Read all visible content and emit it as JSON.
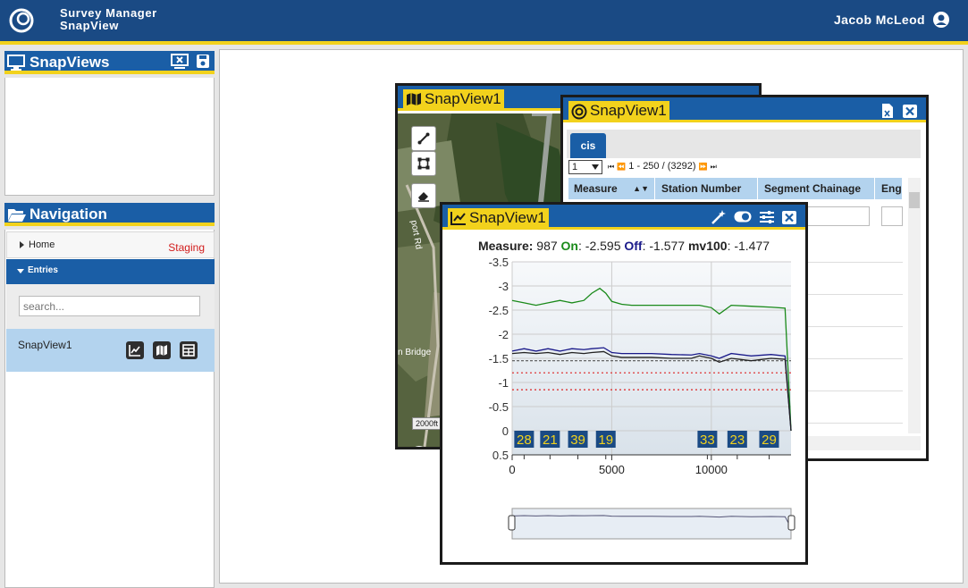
{
  "header": {
    "title_line1": "Survey Manager",
    "title_line2": "SnapView",
    "user_name": "Jacob McLeod",
    "colors": {
      "brand": "#1a4a84",
      "accent": "#f2d21c"
    }
  },
  "snapviews_panel": {
    "title": "SnapViews",
    "icons": [
      "monitor-icon",
      "close-view-icon",
      "save-icon"
    ]
  },
  "navigation_panel": {
    "title": "Navigation",
    "home": {
      "label": "Home",
      "badge": "Staging"
    },
    "entries": {
      "label": "Entries"
    },
    "search": {
      "placeholder": "search..."
    },
    "items": [
      {
        "label": "SnapView1",
        "actions": [
          "chart-icon",
          "map-icon",
          "table-icon"
        ]
      }
    ]
  },
  "map_window": {
    "title": "SnapView1",
    "map_labels": [
      "port Rd",
      "n Bridge"
    ],
    "scale": "2000ft",
    "attribution": "m"
  },
  "table_window": {
    "title": "SnapView1",
    "tab": "cis",
    "pager": {
      "page": "1",
      "range": "1 - 250 / (3292)",
      "controls": [
        "⏮",
        "⏪",
        "⏩",
        "⏭"
      ]
    },
    "columns": [
      "Measure",
      "Station Number",
      "Segment Chainage",
      "Eng"
    ]
  },
  "chart_window": {
    "title": "SnapView1",
    "status": {
      "measure_label": "Measure:",
      "measure_value": "987",
      "on_label": "On",
      "on_value": ": -2.595",
      "off_label": "Off",
      "off_value": ": -1.577",
      "mv_label": "mv100",
      "mv_value": ": -1.477"
    },
    "chart_data": {
      "type": "line",
      "title": "",
      "xlabel": "",
      "ylabel": "",
      "xlim": [
        0,
        14000
      ],
      "ylim": [
        0.5,
        -3.5
      ],
      "xticks": [
        0,
        5000,
        10000
      ],
      "yticks": [
        -3.5,
        -3,
        -2.5,
        -2,
        -1.5,
        -1,
        -0.5,
        0,
        0.5
      ],
      "series": [
        {
          "color": "#1a8a1a",
          "x": [
            0,
            600,
            1200,
            1800,
            2400,
            3000,
            3600,
            4000,
            4400,
            4700,
            5000,
            5500,
            6000,
            7000,
            8000,
            9000,
            9400,
            10000,
            10400,
            11000,
            12000,
            13000,
            13700,
            14000
          ],
          "y": [
            -2.7,
            -2.65,
            -2.6,
            -2.65,
            -2.7,
            -2.65,
            -2.7,
            -2.85,
            -2.95,
            -2.85,
            -2.68,
            -2.62,
            -2.6,
            -2.6,
            -2.6,
            -2.6,
            -2.6,
            -2.55,
            -2.42,
            -2.6,
            -2.58,
            -2.56,
            -2.54,
            0.0
          ]
        },
        {
          "color": "#1a1a8a",
          "x": [
            0,
            600,
            1200,
            1800,
            2400,
            3000,
            3600,
            4000,
            4600,
            5000,
            5500,
            6000,
            7000,
            8000,
            9000,
            9400,
            10000,
            10400,
            11000,
            12000,
            13000,
            13700,
            14000
          ],
          "y": [
            -1.65,
            -1.7,
            -1.65,
            -1.7,
            -1.65,
            -1.7,
            -1.68,
            -1.7,
            -1.72,
            -1.62,
            -1.6,
            -1.6,
            -1.6,
            -1.58,
            -1.57,
            -1.6,
            -1.55,
            -1.5,
            -1.6,
            -1.55,
            -1.58,
            -1.55,
            0.0
          ]
        },
        {
          "color": "#222222",
          "x": [
            0,
            600,
            1200,
            1800,
            2400,
            3000,
            3600,
            4000,
            4600,
            5000,
            5500,
            6000,
            7000,
            8000,
            9000,
            9400,
            10000,
            10400,
            11000,
            12000,
            13000,
            13700,
            14000
          ],
          "y": [
            -1.6,
            -1.62,
            -1.6,
            -1.62,
            -1.58,
            -1.62,
            -1.6,
            -1.62,
            -1.64,
            -1.55,
            -1.52,
            -1.52,
            -1.52,
            -1.5,
            -1.5,
            -1.55,
            -1.5,
            -1.42,
            -1.5,
            -1.45,
            -1.5,
            -1.48,
            0.0
          ]
        }
      ],
      "reference_lines": [
        {
          "y": -1.2,
          "color": "#d22",
          "style": "dotted"
        },
        {
          "y": -0.85,
          "color": "#d22",
          "style": "dotted"
        },
        {
          "y": -1.45,
          "color": "#555",
          "style": "dashed"
        }
      ],
      "markers": [
        {
          "label": "28",
          "x": 600
        },
        {
          "label": "21",
          "x": 1900
        },
        {
          "label": "39",
          "x": 3300
        },
        {
          "label": "19",
          "x": 4700
        },
        {
          "label": "33",
          "x": 9800
        },
        {
          "label": "23",
          "x": 11300
        },
        {
          "label": "29",
          "x": 12900
        }
      ]
    }
  }
}
